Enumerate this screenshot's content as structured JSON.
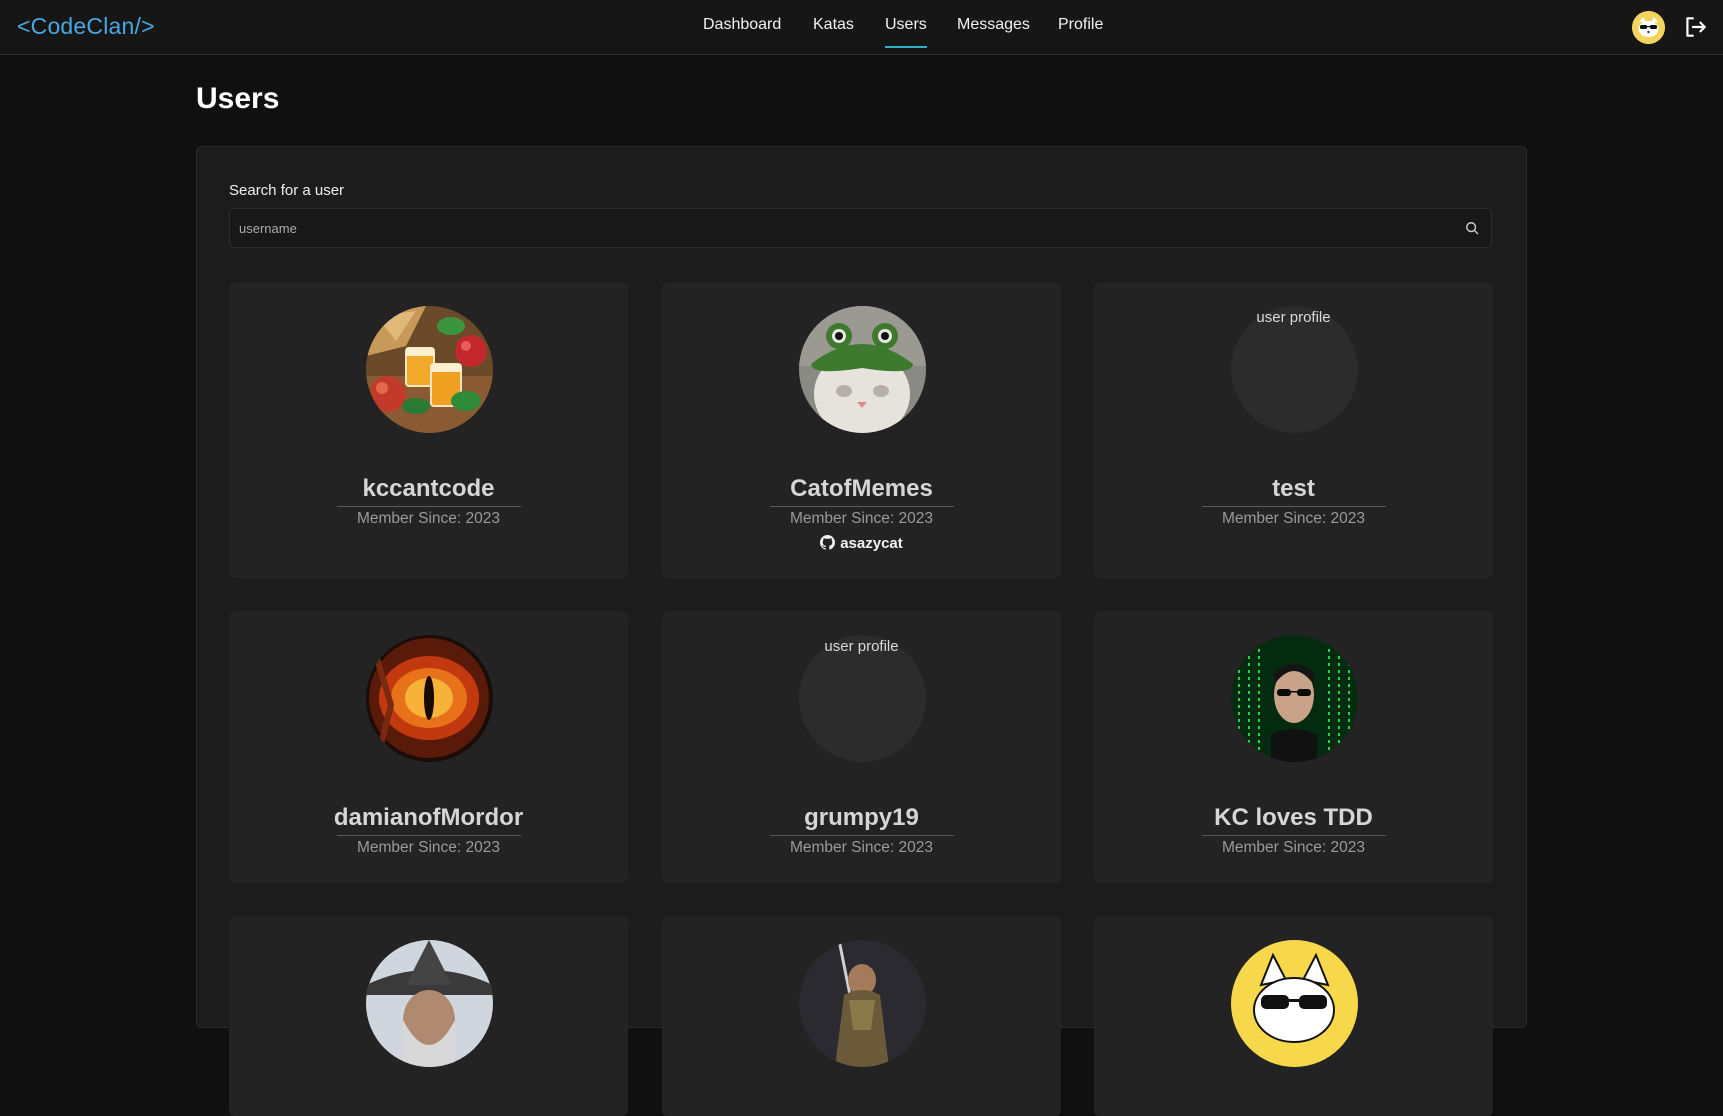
{
  "nav": {
    "logo": "<CodeClan/>",
    "links": [
      "Dashboard",
      "Katas",
      "Users",
      "Messages",
      "Profile"
    ],
    "active": "Users",
    "accent": "#2cb3c8"
  },
  "page": {
    "title": "Users"
  },
  "search": {
    "label": "Search for a user",
    "placeholder": "username"
  },
  "users": [
    {
      "name": "kccantcode",
      "since": "Member Since: 2023",
      "avatar": "apple-cider-drinks-image"
    },
    {
      "name": "CatofMemes",
      "since": "Member Since: 2023",
      "github": "asazycat",
      "avatar": "cat-in-frog-hat-image"
    },
    {
      "name": "test",
      "since": "Member Since: 2023",
      "avatar_alt": "user profile"
    },
    {
      "name": "damianofMordor",
      "since": "Member Since: 2023",
      "avatar": "eye-of-sauron-image"
    },
    {
      "name": "grumpy19",
      "since": "Member Since: 2023",
      "avatar_alt": "user profile"
    },
    {
      "name": "KC loves TDD",
      "since": "Member Since: 2023",
      "avatar": "matrix-neo-image"
    },
    {
      "avatar": "wizard-hat-image"
    },
    {
      "avatar": "warrior-image"
    },
    {
      "avatar": "cat-with-sunglasses-image"
    }
  ]
}
